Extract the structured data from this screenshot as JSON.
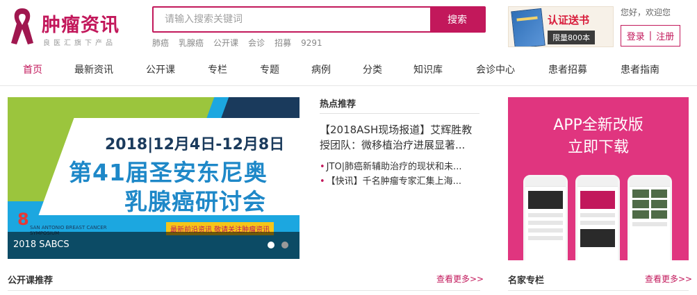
{
  "brand": {
    "title": "肿瘤资讯",
    "subtitle": "良医汇旗下产品",
    "color": "#c2185b"
  },
  "search": {
    "placeholder": "请输入搜索关键词",
    "button_label": "搜索",
    "hot_words": [
      "肺癌",
      "乳腺癌",
      "公开课",
      "会诊",
      "招募",
      "9291"
    ]
  },
  "ad_book": {
    "title": "认证送书",
    "tag": "限量800本"
  },
  "user": {
    "greeting": "您好，欢迎您",
    "login": "登录",
    "separator": "|",
    "register": "注册"
  },
  "nav": {
    "items": [
      {
        "label": "首页",
        "active": true
      },
      {
        "label": "最新资讯"
      },
      {
        "label": "公开课"
      },
      {
        "label": "专栏"
      },
      {
        "label": "专题"
      },
      {
        "label": "病例"
      },
      {
        "label": "分类"
      },
      {
        "label": "知识库"
      },
      {
        "label": "会诊中心"
      },
      {
        "label": "患者招募"
      },
      {
        "label": "患者指南"
      }
    ]
  },
  "banner": {
    "date": "2018|12月4日-12月8日",
    "title_line1": "第41届圣安东尼奥",
    "title_line2": "乳腺癌研讨会",
    "tag": "最新前沿资讯 敬请关注肿瘤资讯",
    "logo_text": "SAN ANTONIO BREAST CANCER SYMPOSIUM",
    "caption": "2018 SABCS"
  },
  "hot": {
    "header": "热点推荐",
    "main": "【2018ASH现场报道】艾辉胜教授团队：微移植治疗进展显著...",
    "list": [
      "JTO|肺癌新辅助治疗的现状和未...",
      "【快讯】千名肿瘤专家汇集上海..."
    ]
  },
  "app_ad": {
    "line1": "APP全新改版",
    "line2": "立即下载"
  },
  "sections": {
    "open_course": {
      "title": "公开课推荐",
      "more": "查看更多>>"
    },
    "experts": {
      "title": "名家专栏",
      "more": "查看更多>>"
    }
  }
}
